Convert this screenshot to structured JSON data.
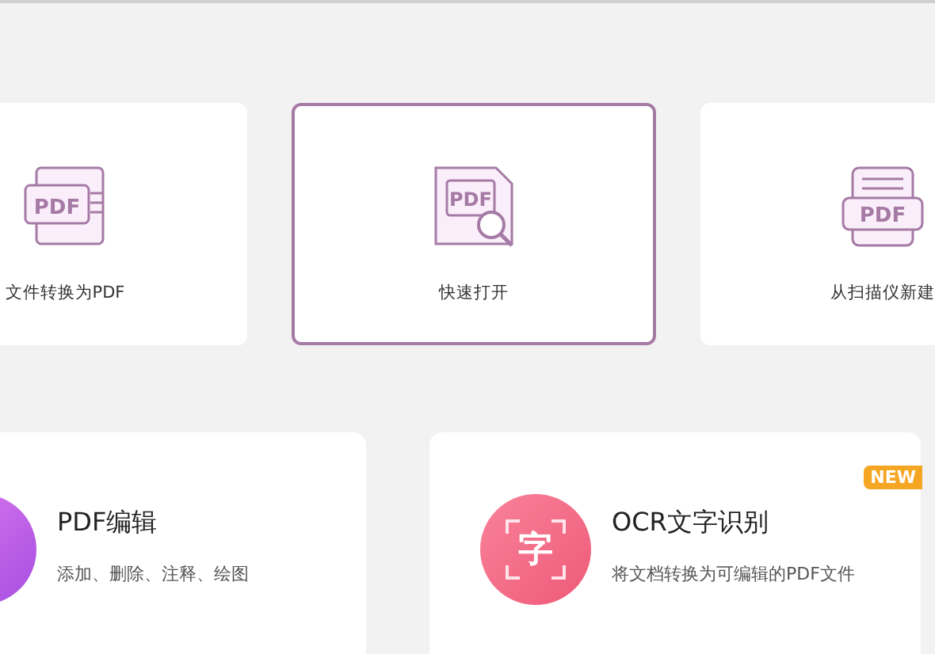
{
  "quick_actions": [
    {
      "kind": "convert",
      "icon_text": "PDF",
      "label": "文件转换为PDF",
      "selected": false
    },
    {
      "kind": "open",
      "icon_text": "PDF",
      "label": "快速打开",
      "selected": true
    },
    {
      "kind": "scan",
      "icon_text": "PDF",
      "label": "从扫描仪新建",
      "selected": false
    }
  ],
  "features": [
    {
      "kind": "edit",
      "title": "PDF编辑",
      "description": "添加、删除、注释、绘图"
    },
    {
      "kind": "ocr",
      "title": "OCR文字识别",
      "description": "将文档转换为可编辑的PDF文件",
      "icon_text": "字",
      "badge": "NEW"
    }
  ]
}
